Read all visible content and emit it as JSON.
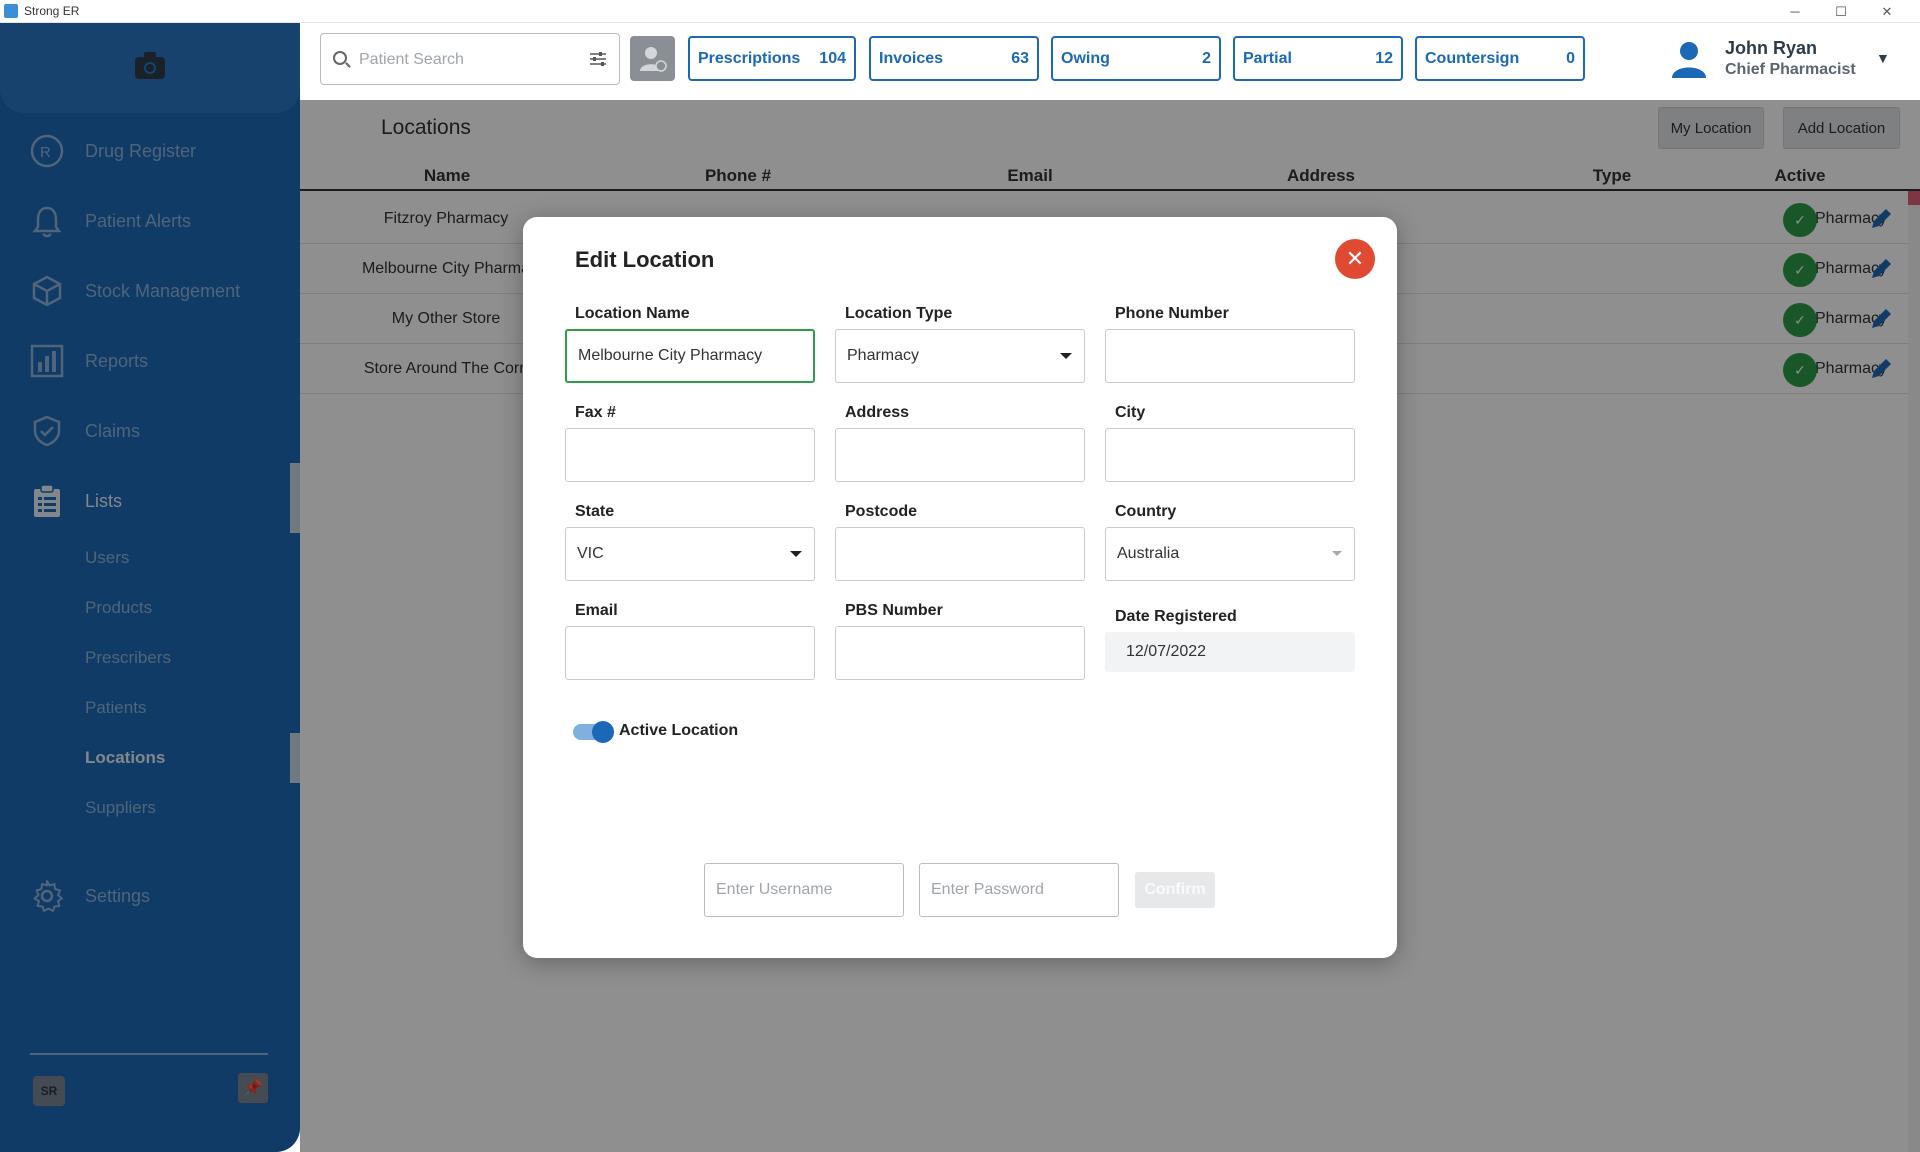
{
  "window": {
    "title": "Strong ER",
    "controls": [
      "─",
      "☐",
      "✕"
    ]
  },
  "sidebar": {
    "items": [
      {
        "label": "Drug Register",
        "icon": "rx-icon"
      },
      {
        "label": "Patient Alerts",
        "icon": "bell-icon"
      },
      {
        "label": "Stock Management",
        "icon": "box-icon"
      },
      {
        "label": "Reports",
        "icon": "bar-chart-icon"
      },
      {
        "label": "Claims",
        "icon": "shield-check-icon"
      },
      {
        "label": "Lists",
        "icon": "clipboard-icon"
      },
      {
        "label": "Settings",
        "icon": "gear-icon"
      }
    ],
    "sub_items": [
      "Users",
      "Products",
      "Prescribers",
      "Patients",
      "Locations",
      "Suppliers"
    ],
    "active_sub": "Locations",
    "logo_text": "SR"
  },
  "search": {
    "placeholder": "Patient Search"
  },
  "quick_buttons": [
    {
      "label": "Prescriptions",
      "count": "104"
    },
    {
      "label": "Invoices",
      "count": "63"
    },
    {
      "label": "Owing",
      "count": "2"
    },
    {
      "label": "Partial",
      "count": "12"
    },
    {
      "label": "Countersign",
      "count": "0"
    }
  ],
  "user": {
    "name": "John Ryan",
    "role": "Chief Pharmacist"
  },
  "page": {
    "title": "Locations",
    "my_location_label": "My Location",
    "add_location_label": "Add Location"
  },
  "table": {
    "headers": [
      "Name",
      "Phone #",
      "Email",
      "Address",
      "Type",
      "Active"
    ],
    "rows": [
      {
        "name": "Fitzroy Pharmacy",
        "type": "Pharmacy",
        "active": "✓"
      },
      {
        "name": "Melbourne City Pharma",
        "type": "Pharmacy",
        "active": "✓"
      },
      {
        "name": "My Other Store",
        "type": "Pharmacy",
        "active": "✓"
      },
      {
        "name": "Store Around The Corn",
        "type": "Pharmacy",
        "active": "✓"
      }
    ]
  },
  "modal": {
    "title": "Edit Location",
    "close": "✕",
    "fields": {
      "location_name": {
        "label": "Location Name",
        "value": "Melbourne City Pharmacy"
      },
      "location_type": {
        "label": "Location Type",
        "value": "Pharmacy"
      },
      "phone_number": {
        "label": "Phone Number",
        "value": ""
      },
      "fax": {
        "label": "Fax #",
        "value": ""
      },
      "address": {
        "label": "Address",
        "value": ""
      },
      "city": {
        "label": "City",
        "value": ""
      },
      "state": {
        "label": "State",
        "value": "VIC"
      },
      "postcode": {
        "label": "Postcode",
        "value": ""
      },
      "country": {
        "label": "Country",
        "value": "Australia"
      },
      "email": {
        "label": "Email",
        "value": ""
      },
      "pbs_number": {
        "label": "PBS Number",
        "value": ""
      },
      "date_registered": {
        "label": "Date Registered",
        "value": "12/07/2022"
      }
    },
    "active_toggle": {
      "label": "Active Location",
      "on": true
    },
    "username_placeholder": "Enter Username",
    "password_placeholder": "Enter Password",
    "confirm_label": "Confirm"
  },
  "colors": {
    "sidebar": "#1b69b6",
    "accent": "#1b69b6",
    "active_green": "#2f9c48",
    "close_red": "#e04a33"
  }
}
